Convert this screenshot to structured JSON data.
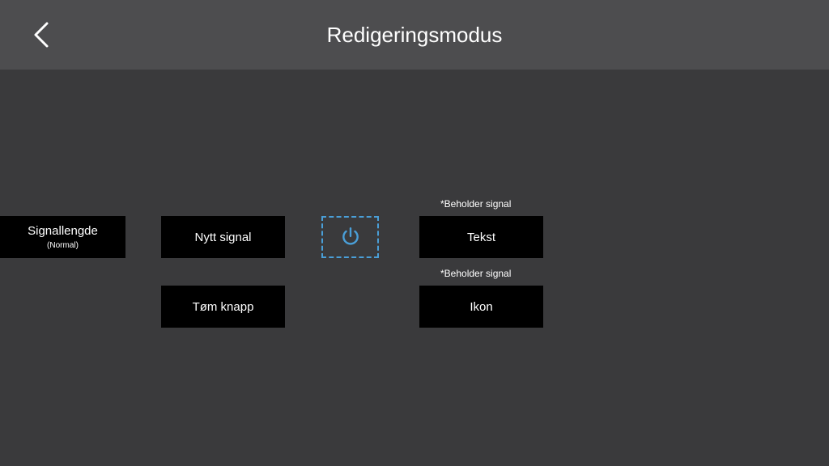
{
  "header": {
    "title": "Redigeringsmodus"
  },
  "signalLength": {
    "label": "Signallengde",
    "sub": "(Normal)"
  },
  "newSignal": {
    "label": "Nytt signal"
  },
  "clear": {
    "label": "Tøm knapp"
  },
  "caption1": "*Beholder signal",
  "caption2": "*Beholder signal",
  "textBtn": {
    "label": "Tekst"
  },
  "iconBtn": {
    "label": "Ikon"
  }
}
